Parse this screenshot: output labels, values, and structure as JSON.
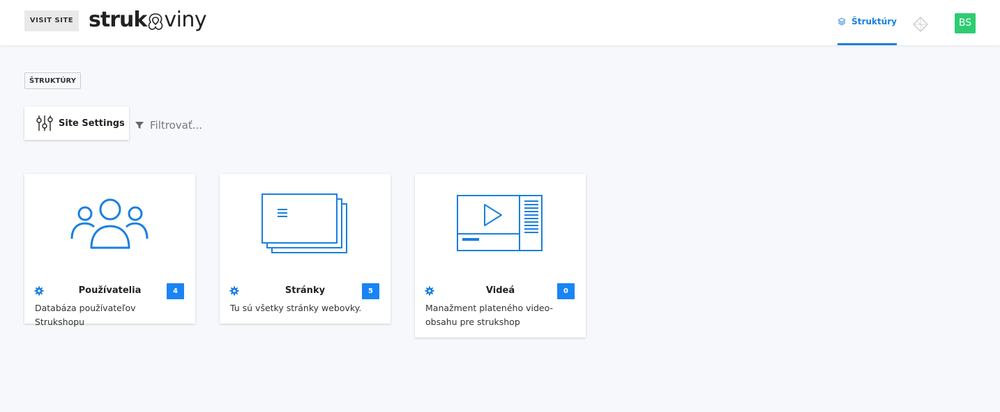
{
  "header": {
    "visit_site_label": "VISIT SITE",
    "logo_bold": "struk",
    "logo_light": "viny",
    "nav_tab_label": "Štruktúry",
    "avatar_initials": "BS",
    "accent_color": "#1a7fe0",
    "avatar_color": "#2ecc71"
  },
  "breadcrumb": {
    "label": "ŠTRUKTÚRY"
  },
  "toolbar": {
    "settings_label": "Site Settings",
    "filter_placeholder": "Filtrovať..."
  },
  "cards": [
    {
      "icon": "users-icon",
      "title": "Používatelia",
      "count": "4",
      "description": "Databáza používateľov Strukshopu"
    },
    {
      "icon": "pages-icon",
      "title": "Stránky",
      "count": "5",
      "description": "Tu sú všetky stránky webovky."
    },
    {
      "icon": "video-icon",
      "title": "Videá",
      "count": "0",
      "description": "Manažment plateného video-obsahu pre strukshop"
    }
  ]
}
